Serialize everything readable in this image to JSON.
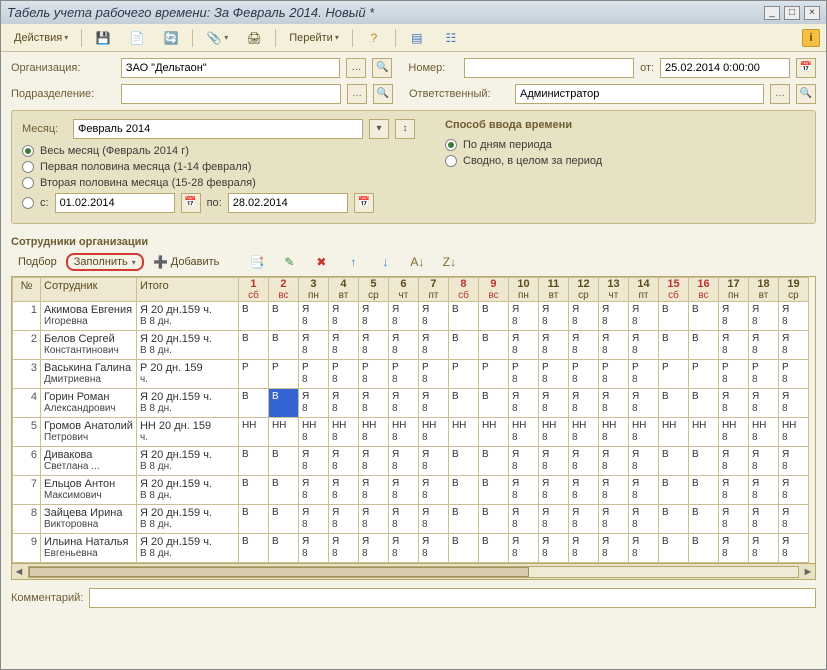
{
  "window": {
    "title": "Табель учета рабочего времени: За Февраль 2014. Новый *"
  },
  "toolbar": {
    "actions": "Действия",
    "go": "Перейти"
  },
  "form": {
    "org_label": "Организация:",
    "org_value": "ЗАО \"Дельтаон\"",
    "dept_label": "Подразделение:",
    "dept_value": "",
    "number_label": "Номер:",
    "number_value": "",
    "date_label": "от:",
    "date_value": "25.02.2014 0:00:00",
    "resp_label": "Ответственный:",
    "resp_value": "Администратор"
  },
  "panel": {
    "month_label": "Месяц:",
    "month_value": "Февраль 2014",
    "opt1": "Весь месяц (Февраль 2014 г)",
    "opt2": "Первая половина месяца (1-14 февраля)",
    "opt3": "Вторая половина месяца (15-28 февраля)",
    "opt4_label": "с:",
    "from": "01.02.2014",
    "to_label": "по:",
    "to": "28.02.2014",
    "mode_title": "Способ ввода времени",
    "mode1": "По дням периода",
    "mode2": "Сводно, в целом за период"
  },
  "section_title": "Сотрудники организации",
  "grid_toolbar": {
    "select": "Подбор",
    "fill": "Заполнить",
    "add": "Добавить"
  },
  "columns": {
    "num": "№",
    "emp": "Сотрудник",
    "total": "Итого"
  },
  "days": [
    {
      "n": "1",
      "wd": "сб",
      "cls": "weekend"
    },
    {
      "n": "2",
      "wd": "вс",
      "cls": "weekend"
    },
    {
      "n": "3",
      "wd": "пн",
      "cls": ""
    },
    {
      "n": "4",
      "wd": "вт",
      "cls": ""
    },
    {
      "n": "5",
      "wd": "ср",
      "cls": ""
    },
    {
      "n": "6",
      "wd": "чт",
      "cls": ""
    },
    {
      "n": "7",
      "wd": "пт",
      "cls": ""
    },
    {
      "n": "8",
      "wd": "сб",
      "cls": "weekend"
    },
    {
      "n": "9",
      "wd": "вс",
      "cls": "weekend"
    },
    {
      "n": "10",
      "wd": "пн",
      "cls": ""
    },
    {
      "n": "11",
      "wd": "вт",
      "cls": ""
    },
    {
      "n": "12",
      "wd": "ср",
      "cls": ""
    },
    {
      "n": "13",
      "wd": "чт",
      "cls": ""
    },
    {
      "n": "14",
      "wd": "пт",
      "cls": ""
    },
    {
      "n": "15",
      "wd": "сб",
      "cls": "weekend"
    },
    {
      "n": "16",
      "wd": "вс",
      "cls": "weekend"
    },
    {
      "n": "17",
      "wd": "пн",
      "cls": ""
    },
    {
      "n": "18",
      "wd": "вт",
      "cls": ""
    },
    {
      "n": "19",
      "wd": "ср",
      "cls": ""
    }
  ],
  "rows": [
    {
      "n": 1,
      "emp": [
        "Акимова Евгения",
        "Игоревна"
      ],
      "total": [
        "Я 20 дн.159 ч.",
        "В 8 дн."
      ],
      "cells": [
        "В",
        "В",
        "Я 8",
        "Я 8",
        "Я 8",
        "Я 8",
        "Я 8",
        "В",
        "В",
        "Я 8",
        "Я 8",
        "Я 8",
        "Я 8",
        "Я 8",
        "В",
        "В",
        "Я 8",
        "Я 8",
        "Я 8"
      ]
    },
    {
      "n": 2,
      "emp": [
        "Белов Сергей",
        "Константинович"
      ],
      "total": [
        "Я 20 дн.159 ч.",
        "В 8 дн."
      ],
      "cells": [
        "В",
        "В",
        "Я 8",
        "Я 8",
        "Я 8",
        "Я 8",
        "Я 8",
        "В",
        "В",
        "Я 8",
        "Я 8",
        "Я 8",
        "Я 8",
        "Я 8",
        "В",
        "В",
        "Я 8",
        "Я 8",
        "Я 8"
      ]
    },
    {
      "n": 3,
      "emp": [
        "Васькина Галина",
        "Дмитриевна"
      ],
      "total": [
        "Р 20 дн. 159",
        "ч."
      ],
      "cells": [
        "Р",
        "Р",
        "Р 8",
        "Р 8",
        "Р 8",
        "Р 8",
        "Р 8",
        "Р",
        "Р",
        "Р 8",
        "Р 8",
        "Р 8",
        "Р 8",
        "Р 8",
        "Р",
        "Р",
        "Р 8",
        "Р 8",
        "Р 8"
      ]
    },
    {
      "n": 4,
      "emp": [
        "Горин Роман",
        "Александрович"
      ],
      "total": [
        "Я 20 дн.159 ч.",
        "В 8 дн."
      ],
      "cells": [
        "В",
        "В",
        "Я 8",
        "Я 8",
        "Я 8",
        "Я 8",
        "Я 8",
        "В",
        "В",
        "Я 8",
        "Я 8",
        "Я 8",
        "Я 8",
        "Я 8",
        "В",
        "В",
        "Я 8",
        "Я 8",
        "Я 8"
      ],
      "sel": 1
    },
    {
      "n": 5,
      "emp": [
        "Громов Анатолий",
        "Петрович"
      ],
      "total": [
        "НН 20 дн. 159",
        "ч."
      ],
      "cells": [
        "НН",
        "НН",
        "НН 8",
        "НН 8",
        "НН 8",
        "НН 8",
        "НН 8",
        "НН",
        "НН",
        "НН 8",
        "НН 8",
        "НН 8",
        "НН 8",
        "НН 8",
        "НН",
        "НН",
        "НН 8",
        "НН 8",
        "НН 8"
      ]
    },
    {
      "n": 6,
      "emp": [
        "Дивакова",
        "Светлана ..."
      ],
      "total": [
        "Я 20 дн.159 ч.",
        "В 8 дн."
      ],
      "cells": [
        "В",
        "В",
        "Я 8",
        "Я 8",
        "Я 8",
        "Я 8",
        "Я 8",
        "В",
        "В",
        "Я 8",
        "Я 8",
        "Я 8",
        "Я 8",
        "Я 8",
        "В",
        "В",
        "Я 8",
        "Я 8",
        "Я 8"
      ]
    },
    {
      "n": 7,
      "emp": [
        "Ельцов Антон",
        "Максимович"
      ],
      "total": [
        "Я 20 дн.159 ч.",
        "В 8 дн."
      ],
      "cells": [
        "В",
        "В",
        "Я 8",
        "Я 8",
        "Я 8",
        "Я 8",
        "Я 8",
        "В",
        "В",
        "Я 8",
        "Я 8",
        "Я 8",
        "Я 8",
        "Я 8",
        "В",
        "В",
        "Я 8",
        "Я 8",
        "Я 8"
      ]
    },
    {
      "n": 8,
      "emp": [
        "Зайцева Ирина",
        "Викторовна"
      ],
      "total": [
        "Я 20 дн.159 ч.",
        "В 8 дн."
      ],
      "cells": [
        "В",
        "В",
        "Я 8",
        "Я 8",
        "Я 8",
        "Я 8",
        "Я 8",
        "В",
        "В",
        "Я 8",
        "Я 8",
        "Я 8",
        "Я 8",
        "Я 8",
        "В",
        "В",
        "Я 8",
        "Я 8",
        "Я 8"
      ]
    },
    {
      "n": 9,
      "emp": [
        "Ильина Наталья",
        "Евгеньевна"
      ],
      "total": [
        "Я 20 дн.159 ч.",
        "В 8 дн."
      ],
      "cells": [
        "В",
        "В",
        "Я 8",
        "Я 8",
        "Я 8",
        "Я 8",
        "Я 8",
        "В",
        "В",
        "Я 8",
        "Я 8",
        "Я 8",
        "Я 8",
        "Я 8",
        "В",
        "В",
        "Я 8",
        "Я 8",
        "Я 8"
      ]
    }
  ],
  "comment_label": "Комментарий:",
  "comment_value": ""
}
